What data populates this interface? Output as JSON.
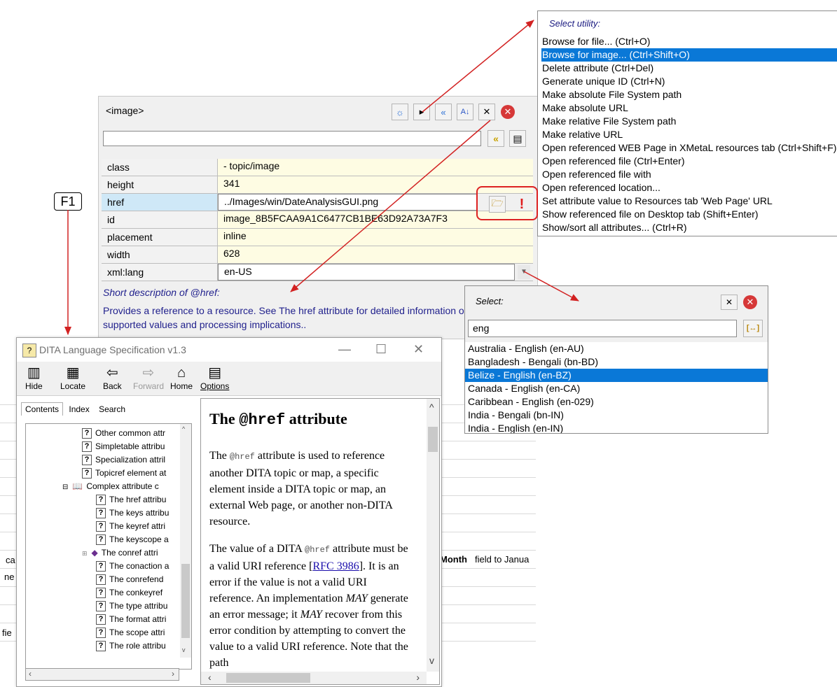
{
  "background": {
    "fragment_1": "ca",
    "fragment_2": "ne",
    "fragment_3": "fie",
    "month_label": "Month",
    "month_text": "field to Janua"
  },
  "inspector": {
    "title": "<image>",
    "filter_value": "",
    "attributes": [
      {
        "name": "class",
        "value": "- topic/image"
      },
      {
        "name": "height",
        "value": "341"
      },
      {
        "name": "href",
        "value": "../Images/win/DateAnalysisGUI.png"
      },
      {
        "name": "id",
        "value": "image_8B5FCAA9A1C6477CB1BE63D92A73A7F3"
      },
      {
        "name": "placement",
        "value": "inline"
      },
      {
        "name": "width",
        "value": "628"
      },
      {
        "name": "xml:lang",
        "value": "en-US"
      }
    ],
    "short_desc_label": "Short description of @href:",
    "short_desc_text": "Provides a reference to a resource. See The href attribute for detailed information on supported values and processing implications.."
  },
  "utility_menu": {
    "title": "Select utility:",
    "items": [
      "Browse for file... (Ctrl+O)",
      "Browse for image... (Ctrl+Shift+O)",
      "Delete attribute (Ctrl+Del)",
      "Generate unique ID (Ctrl+N)",
      "Make absolute File System path",
      "Make absolute URL",
      "Make relative File System path",
      "Make relative URL",
      "Open referenced WEB Page in XMetaL resources tab (Ctrl+Shift+F)",
      "Open referenced file (Ctrl+Enter)",
      "Open referenced file with",
      "Open referenced location...",
      "Set attribute value to Resources tab 'Web Page' URL",
      "Show referenced file on Desktop tab (Shift+Enter)",
      "Show/sort all attributes... (Ctrl+R)"
    ],
    "highlighted_index": 1
  },
  "lang_popup": {
    "title": "Select:",
    "input_value": "eng",
    "items": [
      "Australia - English (en-AU)",
      "Bangladesh - Bengali (bn-BD)",
      "Belize - English (en-BZ)",
      "Canada - English (en-CA)",
      "Caribbean - English (en-029)",
      "India - Bengali (bn-IN)",
      "India - English (en-IN)"
    ],
    "highlighted_index": 2
  },
  "f1_label": "F1",
  "help_window": {
    "title": "DITA Language Specification v1.3",
    "toolbar": [
      "Hide",
      "Locate",
      "Back",
      "Forward",
      "Home",
      "Options"
    ],
    "tabs": [
      "Contents",
      "Index",
      "Search"
    ],
    "toc": [
      "Other common attr",
      "Simpletable attribu",
      "Specialization attril",
      "Topicref element at",
      "Complex attribute c",
      "The href attribu",
      "The keys attribu",
      "The keyref attri",
      "The keyscope a",
      "The conref attri",
      "The conaction a",
      "The conrefend",
      "The conkeyref",
      "The type attribu",
      "The format attri",
      "The scope attri",
      "The role attribu"
    ],
    "heading_pre": "The ",
    "heading_code": "@href",
    "heading_post": " attribute",
    "p1_a": "The ",
    "p1_code": "@href",
    "p1_b": " attribute is used to reference another DITA topic or map, a specific element inside a DITA topic or map, an external Web page, or another non-DITA resource.",
    "p2_a": "The value of a DITA ",
    "p2_code": "@href",
    "p2_b": " attribute must be a valid URI reference [",
    "p2_link": "RFC 3986",
    "p2_c": "]. It is an error if the value is not a valid URI reference. An implementation ",
    "p2_may1": "MAY",
    "p2_d": " generate an error message; it ",
    "p2_may2": "MAY",
    "p2_e": " recover from this error condition by attempting to convert the value to a valid URI reference. Note that the path"
  },
  "colors": {
    "highlight": "#0a78d7",
    "arrow": "#d22222",
    "value_bg": "#fefce3",
    "desc_text": "#1f1f8c"
  }
}
